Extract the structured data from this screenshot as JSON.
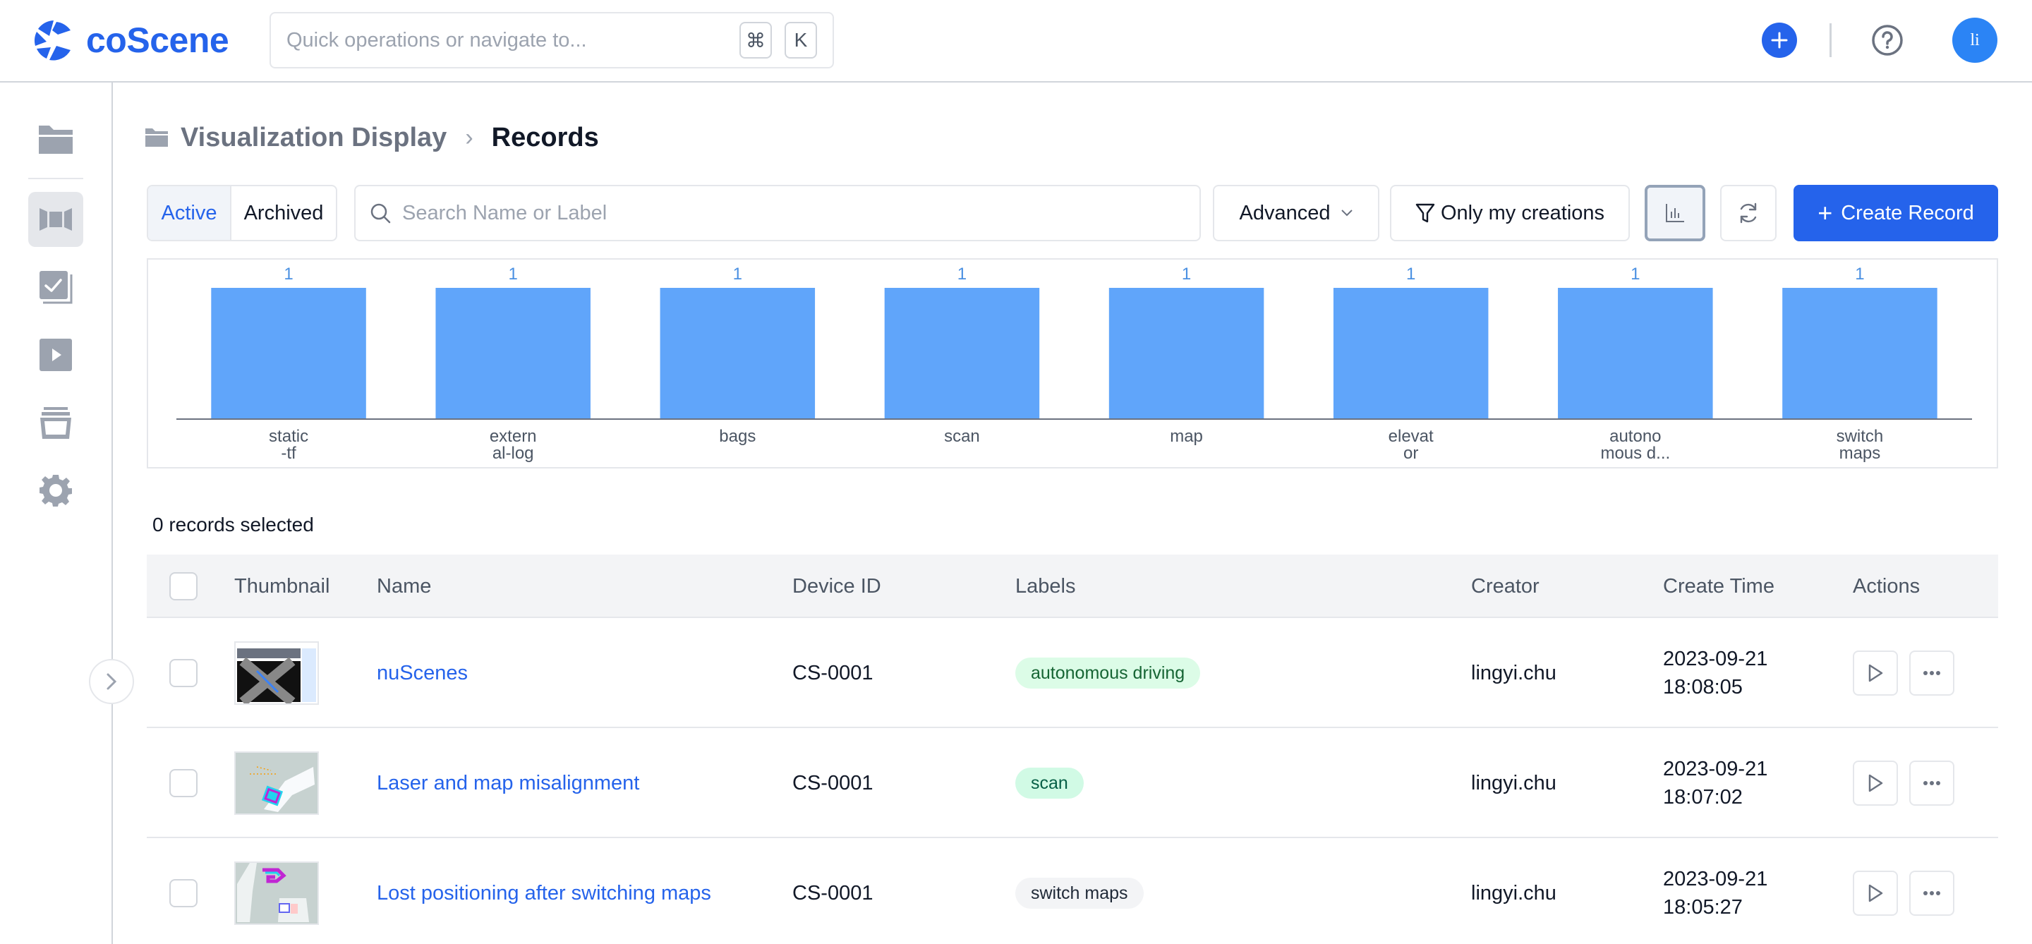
{
  "app": {
    "brand": "coScene",
    "brand_color": "#2563eb",
    "quick_search_placeholder": "Quick operations or navigate to...",
    "shortcut_keys": [
      "⌘",
      "K"
    ],
    "avatar_initials": "li"
  },
  "sidebar": {
    "items": [
      {
        "icon": "folder-icon",
        "active": false
      },
      {
        "icon": "visualization-icon",
        "active": true
      },
      {
        "icon": "tasks-icon",
        "active": false
      },
      {
        "icon": "play-icon",
        "active": false
      },
      {
        "icon": "archive-icon",
        "active": false
      },
      {
        "icon": "gear-icon",
        "active": false
      }
    ],
    "collapse_icon": "chevron-right-icon"
  },
  "breadcrumb": {
    "parent": "Visualization Display",
    "separator": "›",
    "current": "Records"
  },
  "toolbar": {
    "tabs": [
      {
        "label": "Active",
        "active": true
      },
      {
        "label": "Archived",
        "active": false
      }
    ],
    "search_placeholder": "Search Name or Label",
    "search_value": "",
    "advanced_label": "Advanced",
    "only_mine_label": "Only my creations",
    "create_label": "Create Record"
  },
  "chart_data": {
    "type": "bar",
    "title": "",
    "xlabel": "",
    "ylabel": "",
    "categories": [
      "static-tf",
      "external-log",
      "bags",
      "scan",
      "map",
      "elevator",
      "autonomous driving",
      "switch maps"
    ],
    "category_labels": [
      [
        "static",
        "-tf"
      ],
      [
        "extern",
        "al-log"
      ],
      [
        "bags"
      ],
      [
        "scan"
      ],
      [
        "map"
      ],
      [
        "elevat",
        "or"
      ],
      [
        "autono",
        "mous d..."
      ],
      [
        "switch",
        "maps"
      ]
    ],
    "values": [
      1,
      1,
      1,
      1,
      1,
      1,
      1,
      1
    ],
    "ylim": [
      0,
      1
    ],
    "grid": false,
    "bar_color": "#60a5fa",
    "label_color": "#4a90e2"
  },
  "selection": {
    "text": "0 records selected"
  },
  "table": {
    "columns": [
      "Thumbnail",
      "Name",
      "Device ID",
      "Labels",
      "Creator",
      "Create Time",
      "Actions"
    ],
    "rows": [
      {
        "thumbnail": "nuscenes-intersection",
        "name": "nuScenes",
        "device_id": "CS-0001",
        "label": "autonomous driving",
        "label_bg": "#dcfce7",
        "label_fg": "#166534",
        "creator": "lingyi.chu",
        "date": "2023-09-21",
        "time": "18:08:05"
      },
      {
        "thumbnail": "laser-map",
        "name": "Laser and map misalignment",
        "device_id": "CS-0001",
        "label": "scan",
        "label_bg": "#d1fae5",
        "label_fg": "#065f46",
        "creator": "lingyi.chu",
        "date": "2023-09-21",
        "time": "18:07:02"
      },
      {
        "thumbnail": "switch-maps",
        "name": "Lost positioning after switching maps",
        "device_id": "CS-0001",
        "label": "switch maps",
        "label_bg": "#f3f4f6",
        "label_fg": "#1f2937",
        "creator": "lingyi.chu",
        "date": "2023-09-21",
        "time": "18:05:27"
      }
    ]
  }
}
